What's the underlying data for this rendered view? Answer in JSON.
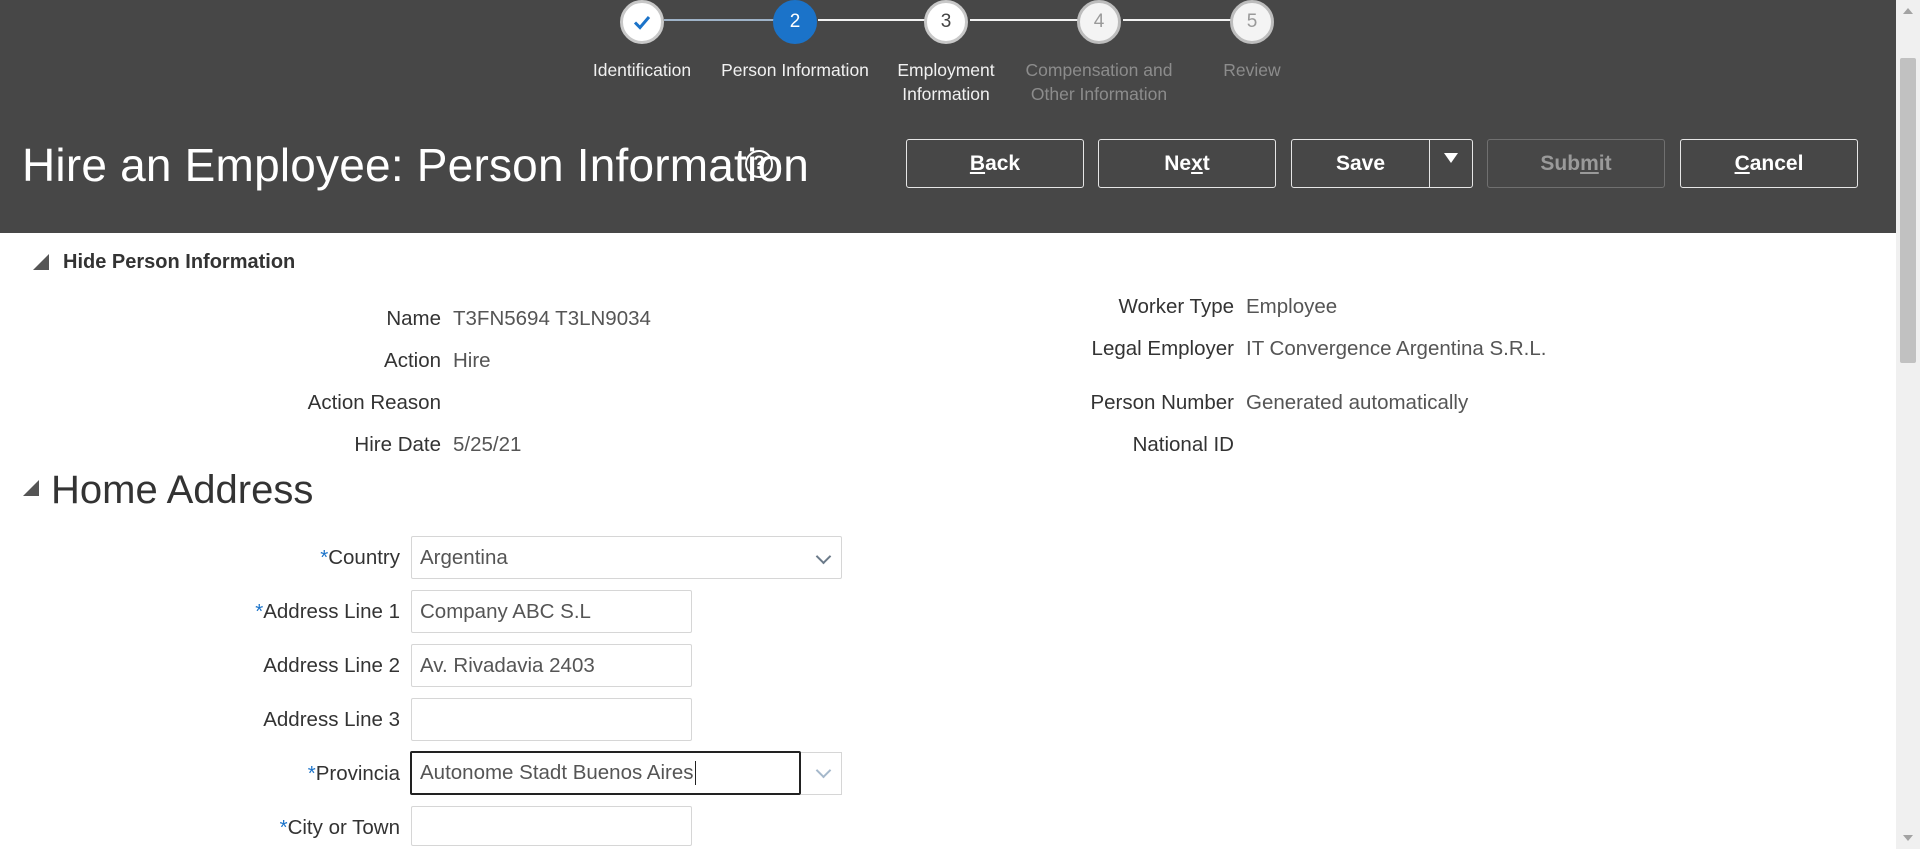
{
  "train": {
    "steps": [
      {
        "number": "",
        "label": "Identification",
        "state": "visited"
      },
      {
        "number": "2",
        "label": "Person Information",
        "state": "current"
      },
      {
        "number": "3",
        "label": "Employment Information",
        "state": "unvisited"
      },
      {
        "number": "4",
        "label": "Compensation and Other Information",
        "state": "disabled"
      },
      {
        "number": "5",
        "label": "Review",
        "state": "disabled"
      }
    ]
  },
  "header": {
    "title": "Hire an Employee: Person Information",
    "help_icon": "help-circle-icon",
    "buttons": {
      "back_pre": "",
      "back_key": "B",
      "back_post": "ack",
      "next_pre": "Ne",
      "next_key": "x",
      "next_post": "t",
      "save": "Save",
      "submit_pre": "Sub",
      "submit_key": "m",
      "submit_post": "it",
      "cancel_pre": "",
      "cancel_key": "C",
      "cancel_post": "ancel"
    }
  },
  "person_info": {
    "toggle_label": "Hide Person Information",
    "left": [
      {
        "label": "Name",
        "value": "T3FN5694 T3LN9034"
      },
      {
        "label": "Action",
        "value": "Hire"
      },
      {
        "label": "Action Reason",
        "value": ""
      },
      {
        "label": "Hire Date",
        "value": "5/25/21"
      }
    ],
    "right": [
      {
        "label": "Worker Type",
        "value": "Employee"
      },
      {
        "label": "Legal Employer",
        "value": "IT Convergence Argentina S.R.L."
      },
      {
        "label": "Person Number",
        "value": "Generated automatically"
      },
      {
        "label": "National ID",
        "value": ""
      }
    ]
  },
  "home_address": {
    "title": "Home Address",
    "required_marker": "*",
    "fields": {
      "country": {
        "label": "Country",
        "value": "Argentina",
        "required": true
      },
      "address1": {
        "label": "Address Line 1",
        "value": "Company ABC S.L",
        "required": true
      },
      "address2": {
        "label": "Address Line 2",
        "value": "Av. Rivadavia 2403",
        "required": false
      },
      "address3": {
        "label": "Address Line 3",
        "value": "",
        "required": false
      },
      "provincia": {
        "label": "Provincia",
        "value": "Autonome Stadt Buenos Aires",
        "required": true
      },
      "city": {
        "label": "City or Town",
        "value": "",
        "required": true
      }
    }
  },
  "colors": {
    "header_bg": "#474747",
    "accent": "#1b73c9",
    "required": "#1b73c9"
  }
}
